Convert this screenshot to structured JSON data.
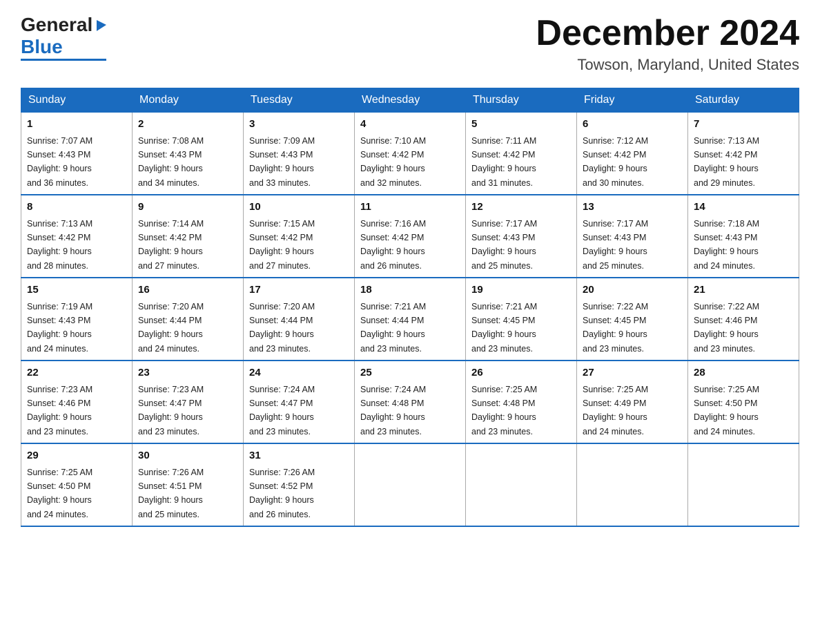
{
  "header": {
    "logo_general": "General",
    "logo_blue": "Blue",
    "month_title": "December 2024",
    "location": "Towson, Maryland, United States"
  },
  "days_of_week": [
    "Sunday",
    "Monday",
    "Tuesday",
    "Wednesday",
    "Thursday",
    "Friday",
    "Saturday"
  ],
  "weeks": [
    [
      {
        "day": "1",
        "sunrise": "7:07 AM",
        "sunset": "4:43 PM",
        "daylight": "9 hours and 36 minutes."
      },
      {
        "day": "2",
        "sunrise": "7:08 AM",
        "sunset": "4:43 PM",
        "daylight": "9 hours and 34 minutes."
      },
      {
        "day": "3",
        "sunrise": "7:09 AM",
        "sunset": "4:43 PM",
        "daylight": "9 hours and 33 minutes."
      },
      {
        "day": "4",
        "sunrise": "7:10 AM",
        "sunset": "4:42 PM",
        "daylight": "9 hours and 32 minutes."
      },
      {
        "day": "5",
        "sunrise": "7:11 AM",
        "sunset": "4:42 PM",
        "daylight": "9 hours and 31 minutes."
      },
      {
        "day": "6",
        "sunrise": "7:12 AM",
        "sunset": "4:42 PM",
        "daylight": "9 hours and 30 minutes."
      },
      {
        "day": "7",
        "sunrise": "7:13 AM",
        "sunset": "4:42 PM",
        "daylight": "9 hours and 29 minutes."
      }
    ],
    [
      {
        "day": "8",
        "sunrise": "7:13 AM",
        "sunset": "4:42 PM",
        "daylight": "9 hours and 28 minutes."
      },
      {
        "day": "9",
        "sunrise": "7:14 AM",
        "sunset": "4:42 PM",
        "daylight": "9 hours and 27 minutes."
      },
      {
        "day": "10",
        "sunrise": "7:15 AM",
        "sunset": "4:42 PM",
        "daylight": "9 hours and 27 minutes."
      },
      {
        "day": "11",
        "sunrise": "7:16 AM",
        "sunset": "4:42 PM",
        "daylight": "9 hours and 26 minutes."
      },
      {
        "day": "12",
        "sunrise": "7:17 AM",
        "sunset": "4:43 PM",
        "daylight": "9 hours and 25 minutes."
      },
      {
        "day": "13",
        "sunrise": "7:17 AM",
        "sunset": "4:43 PM",
        "daylight": "9 hours and 25 minutes."
      },
      {
        "day": "14",
        "sunrise": "7:18 AM",
        "sunset": "4:43 PM",
        "daylight": "9 hours and 24 minutes."
      }
    ],
    [
      {
        "day": "15",
        "sunrise": "7:19 AM",
        "sunset": "4:43 PM",
        "daylight": "9 hours and 24 minutes."
      },
      {
        "day": "16",
        "sunrise": "7:20 AM",
        "sunset": "4:44 PM",
        "daylight": "9 hours and 24 minutes."
      },
      {
        "day": "17",
        "sunrise": "7:20 AM",
        "sunset": "4:44 PM",
        "daylight": "9 hours and 23 minutes."
      },
      {
        "day": "18",
        "sunrise": "7:21 AM",
        "sunset": "4:44 PM",
        "daylight": "9 hours and 23 minutes."
      },
      {
        "day": "19",
        "sunrise": "7:21 AM",
        "sunset": "4:45 PM",
        "daylight": "9 hours and 23 minutes."
      },
      {
        "day": "20",
        "sunrise": "7:22 AM",
        "sunset": "4:45 PM",
        "daylight": "9 hours and 23 minutes."
      },
      {
        "day": "21",
        "sunrise": "7:22 AM",
        "sunset": "4:46 PM",
        "daylight": "9 hours and 23 minutes."
      }
    ],
    [
      {
        "day": "22",
        "sunrise": "7:23 AM",
        "sunset": "4:46 PM",
        "daylight": "9 hours and 23 minutes."
      },
      {
        "day": "23",
        "sunrise": "7:23 AM",
        "sunset": "4:47 PM",
        "daylight": "9 hours and 23 minutes."
      },
      {
        "day": "24",
        "sunrise": "7:24 AM",
        "sunset": "4:47 PM",
        "daylight": "9 hours and 23 minutes."
      },
      {
        "day": "25",
        "sunrise": "7:24 AM",
        "sunset": "4:48 PM",
        "daylight": "9 hours and 23 minutes."
      },
      {
        "day": "26",
        "sunrise": "7:25 AM",
        "sunset": "4:48 PM",
        "daylight": "9 hours and 23 minutes."
      },
      {
        "day": "27",
        "sunrise": "7:25 AM",
        "sunset": "4:49 PM",
        "daylight": "9 hours and 24 minutes."
      },
      {
        "day": "28",
        "sunrise": "7:25 AM",
        "sunset": "4:50 PM",
        "daylight": "9 hours and 24 minutes."
      }
    ],
    [
      {
        "day": "29",
        "sunrise": "7:25 AM",
        "sunset": "4:50 PM",
        "daylight": "9 hours and 24 minutes."
      },
      {
        "day": "30",
        "sunrise": "7:26 AM",
        "sunset": "4:51 PM",
        "daylight": "9 hours and 25 minutes."
      },
      {
        "day": "31",
        "sunrise": "7:26 AM",
        "sunset": "4:52 PM",
        "daylight": "9 hours and 26 minutes."
      },
      null,
      null,
      null,
      null
    ]
  ],
  "labels": {
    "sunrise": "Sunrise:",
    "sunset": "Sunset:",
    "daylight": "Daylight:"
  }
}
